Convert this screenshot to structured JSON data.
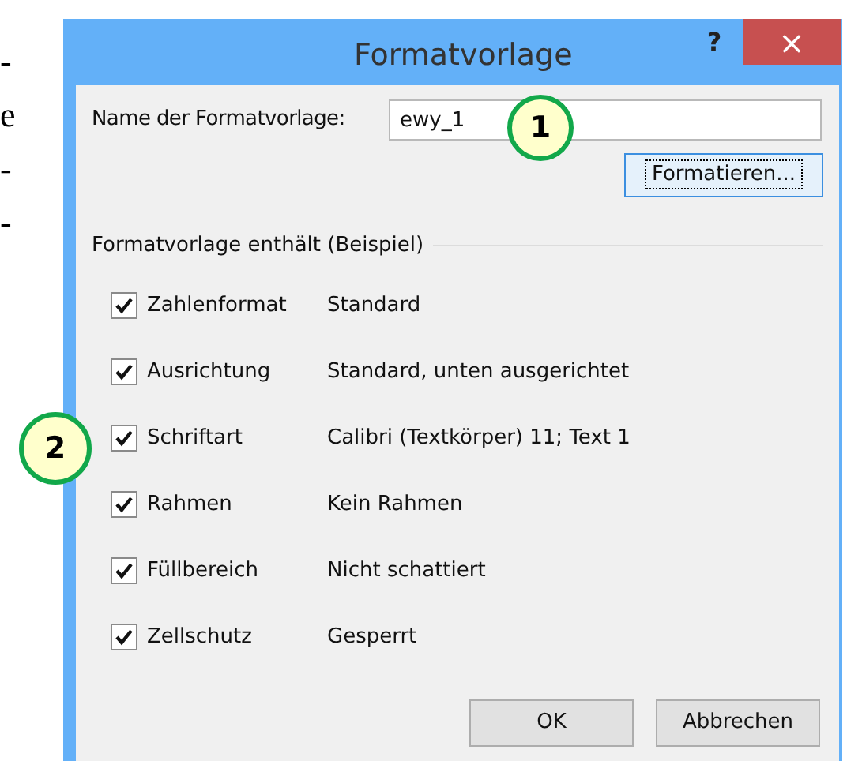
{
  "document_fragment": [
    "-",
    "e",
    "-",
    "-"
  ],
  "window": {
    "title": "Formatvorlage",
    "help": "?",
    "close": "×"
  },
  "name_field": {
    "label": "Name der Formatvorlage:",
    "value": "ewy_1"
  },
  "format_button": {
    "label": "Formatieren...",
    "focused": true
  },
  "group": {
    "title": "Formatvorlage enthält (Beispiel)"
  },
  "items": [
    {
      "label": "Zahlenformat",
      "checked": true,
      "value": "Standard"
    },
    {
      "label": "Ausrichtung",
      "checked": true,
      "value": "Standard, unten ausgerichtet"
    },
    {
      "label": "Schriftart",
      "checked": true,
      "value": "Calibri (Textkörper) 11; Text 1"
    },
    {
      "label": "Rahmen",
      "checked": true,
      "value": "Kein Rahmen"
    },
    {
      "label": "Füllbereich",
      "checked": true,
      "value": "Nicht schattiert"
    },
    {
      "label": "Zellschutz",
      "checked": true,
      "value": "Gesperrt"
    }
  ],
  "buttons": [
    "OK",
    "Abbrechen"
  ],
  "callouts": [
    {
      "label": "1"
    },
    {
      "label": "2"
    }
  ]
}
